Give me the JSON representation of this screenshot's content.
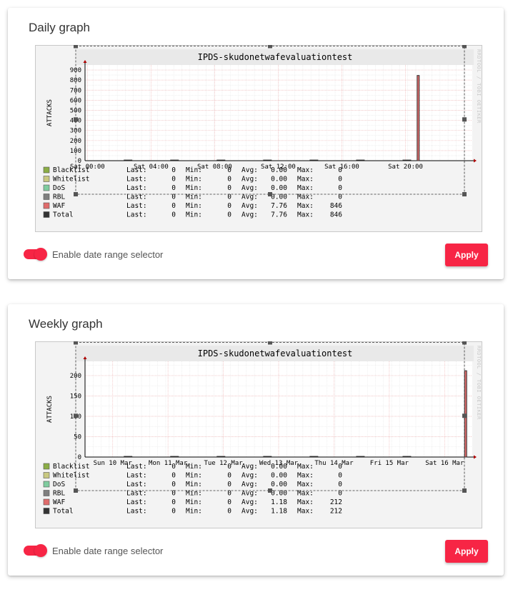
{
  "daily": {
    "title": "Daily graph",
    "toggle_label": "Enable date range selector",
    "apply_label": "Apply"
  },
  "weekly": {
    "title": "Weekly graph",
    "toggle_label": "Enable date range selector",
    "apply_label": "Apply"
  },
  "chart_data": [
    {
      "type": "bar",
      "title": "IPDS-skudonetwafevaluationtest",
      "ylabel": "ATTACKS",
      "watermark": "RRDTOOL / TOBI OETIKER",
      "ylim": [
        0,
        950
      ],
      "yticks": [
        0,
        100,
        200,
        300,
        400,
        500,
        600,
        700,
        800,
        900
      ],
      "xticks": [
        "Sat 00:00",
        "Sat 04:00",
        "Sat 08:00",
        "Sat 12:00",
        "Sat 16:00",
        "Sat 20:00"
      ],
      "xlim": [
        -0.15,
        24.2
      ],
      "x_positions": [
        0,
        4,
        8,
        12,
        16,
        20
      ],
      "spikes": [
        {
          "x": 20.8,
          "value": 846
        }
      ],
      "legend": [
        {
          "name": "Blacklist",
          "color": "#8bad45",
          "last": "0",
          "min": "0",
          "avg": "0.00",
          "max": "0"
        },
        {
          "name": "Whitelist",
          "color": "#c8c880",
          "last": "0",
          "min": "0",
          "avg": "0.00",
          "max": "0"
        },
        {
          "name": "DoS",
          "color": "#7fcc9f",
          "last": "0",
          "min": "0",
          "avg": "0.00",
          "max": "0"
        },
        {
          "name": "RBL",
          "color": "#7f7f7f",
          "last": "0",
          "min": "0",
          "avg": "0.00",
          "max": "0"
        },
        {
          "name": "WAF",
          "color": "#e06c6c",
          "last": "0",
          "min": "0",
          "avg": "7.76",
          "max": "846"
        },
        {
          "name": "Total",
          "color": "#333333",
          "last": "0",
          "min": "0",
          "avg": "7.76",
          "max": "846"
        }
      ],
      "stat_labels": {
        "last": "Last:",
        "min": "Min:",
        "avg": "Avg:",
        "max": "Max:"
      }
    },
    {
      "type": "bar",
      "title": "IPDS-skudonetwafevaluationtest",
      "ylabel": "ATTACKS",
      "watermark": "RRDTOOL / TOBI OETIKER",
      "ylim": [
        0,
        235
      ],
      "yticks": [
        0,
        50,
        100,
        150,
        200
      ],
      "xticks": [
        "Sun 10 Mar",
        "Mon 11 Mar",
        "Tue 12 Mar",
        "Wed 13 Mar",
        "Thu 14 Mar",
        "Fri 15 Mar",
        "Sat 16 Mar"
      ],
      "xlim": [
        0,
        7
      ],
      "x_positions": [
        0.5,
        1.5,
        2.5,
        3.5,
        4.5,
        5.5,
        6.5
      ],
      "spikes": [
        {
          "x": 6.88,
          "value": 212
        }
      ],
      "legend": [
        {
          "name": "Blacklist",
          "color": "#8bad45",
          "last": "0",
          "min": "0",
          "avg": "0.00",
          "max": "0"
        },
        {
          "name": "Whitelist",
          "color": "#c8c880",
          "last": "0",
          "min": "0",
          "avg": "0.00",
          "max": "0"
        },
        {
          "name": "DoS",
          "color": "#7fcc9f",
          "last": "0",
          "min": "0",
          "avg": "0.00",
          "max": "0"
        },
        {
          "name": "RBL",
          "color": "#7f7f7f",
          "last": "0",
          "min": "0",
          "avg": "0.00",
          "max": "0"
        },
        {
          "name": "WAF",
          "color": "#e06c6c",
          "last": "0",
          "min": "0",
          "avg": "1.18",
          "max": "212"
        },
        {
          "name": "Total",
          "color": "#333333",
          "last": "0",
          "min": "0",
          "avg": "1.18",
          "max": "212"
        }
      ],
      "stat_labels": {
        "last": "Last:",
        "min": "Min:",
        "avg": "Avg:",
        "max": "Max:"
      }
    }
  ]
}
